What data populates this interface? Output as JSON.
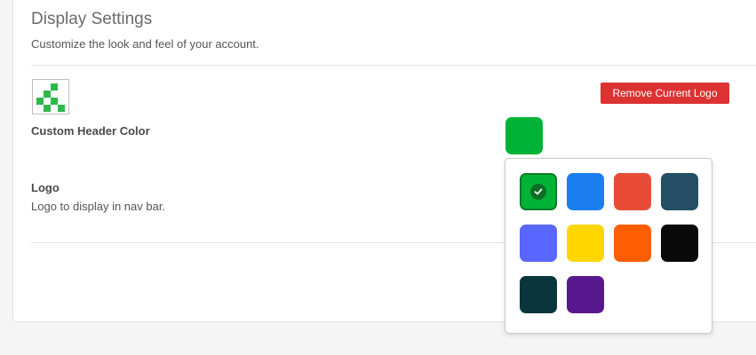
{
  "header": {
    "title": "Display Settings",
    "subtitle": "Customize the look and feel of your account."
  },
  "logo": {
    "remove_label": "Remove Current Logo",
    "label": "Logo",
    "description": "Logo to display in nav bar.",
    "pixel_color": "#2db84b"
  },
  "header_color": {
    "label": "Custom Header Color",
    "current": "#00b336"
  },
  "palette": {
    "selected": "#00b336",
    "colors": [
      "#00b336",
      "#1a7ef0",
      "#e84c37",
      "#234e64",
      "#5a67ff",
      "#ffd600",
      "#ff5e00",
      "#0a0a0a",
      "#09363d",
      "#58198f"
    ]
  },
  "theme": {
    "danger": "#dc3232"
  }
}
